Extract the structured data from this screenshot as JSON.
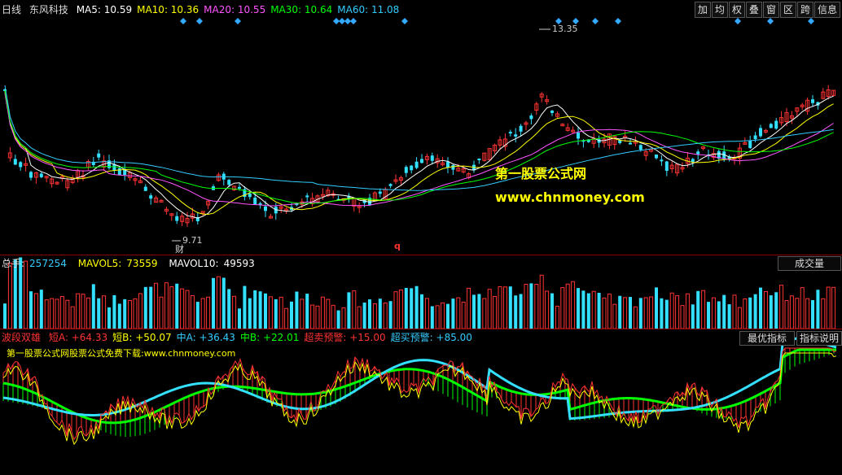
{
  "price_panel": {
    "period": "日线",
    "stock": "东风科技",
    "ma": [
      {
        "label": "MA5:",
        "value": "10.59",
        "color": "#ffffff"
      },
      {
        "label": "MA10:",
        "value": "10.36",
        "color": "#ffff00"
      },
      {
        "label": "MA20:",
        "value": "10.55",
        "color": "#ff55ff"
      },
      {
        "label": "MA30:",
        "value": "10.64",
        "color": "#00ff00"
      },
      {
        "label": "MA60:",
        "value": "11.08",
        "color": "#33ccff"
      }
    ],
    "high_label": "13.35",
    "low_label": "9.71",
    "marker_cai": "财",
    "marker_q": "q",
    "watermark_1": "第一股票公式网",
    "watermark_2": "www.chnmoney.com"
  },
  "toolbar": [
    "加",
    "均",
    "权",
    "叠",
    "窗",
    "区",
    "跨",
    "信息"
  ],
  "volume_panel": {
    "total_label": "总手:",
    "total_value": "257254",
    "mavol5_label": "MAVOL5:",
    "mavol5_value": "73559",
    "mavol10_label": "MAVOL10:",
    "mavol10_value": "49593",
    "button": "成交量"
  },
  "indicator_panel": {
    "name": "波段双雄",
    "items": [
      {
        "label": "短A:",
        "value": "+64.33",
        "color": "#ff3333"
      },
      {
        "label": "短B:",
        "value": "+50.07",
        "color": "#ffff00"
      },
      {
        "label": "中A:",
        "value": "+36.43",
        "color": "#33ccff"
      },
      {
        "label": "中B:",
        "value": "+22.01",
        "color": "#00ff00"
      },
      {
        "label": "超卖预警:",
        "value": "+15.00",
        "color": "#ff3333"
      },
      {
        "label": "超买预警:",
        "value": "+85.00",
        "color": "#33ccff"
      }
    ],
    "note": "第一股票公式网股票公式免费下载:www.chnmoney.com",
    "button_best": "最优指标",
    "button_help": "指标说明"
  },
  "colors": {
    "up": "#ff3333",
    "down": "#33e0ff",
    "grid": "#8b0000",
    "ma5": "#ffffff",
    "ma10": "#ffff00",
    "ma20": "#ff55ff",
    "ma30": "#00ff00",
    "ma60": "#33ccff"
  }
}
